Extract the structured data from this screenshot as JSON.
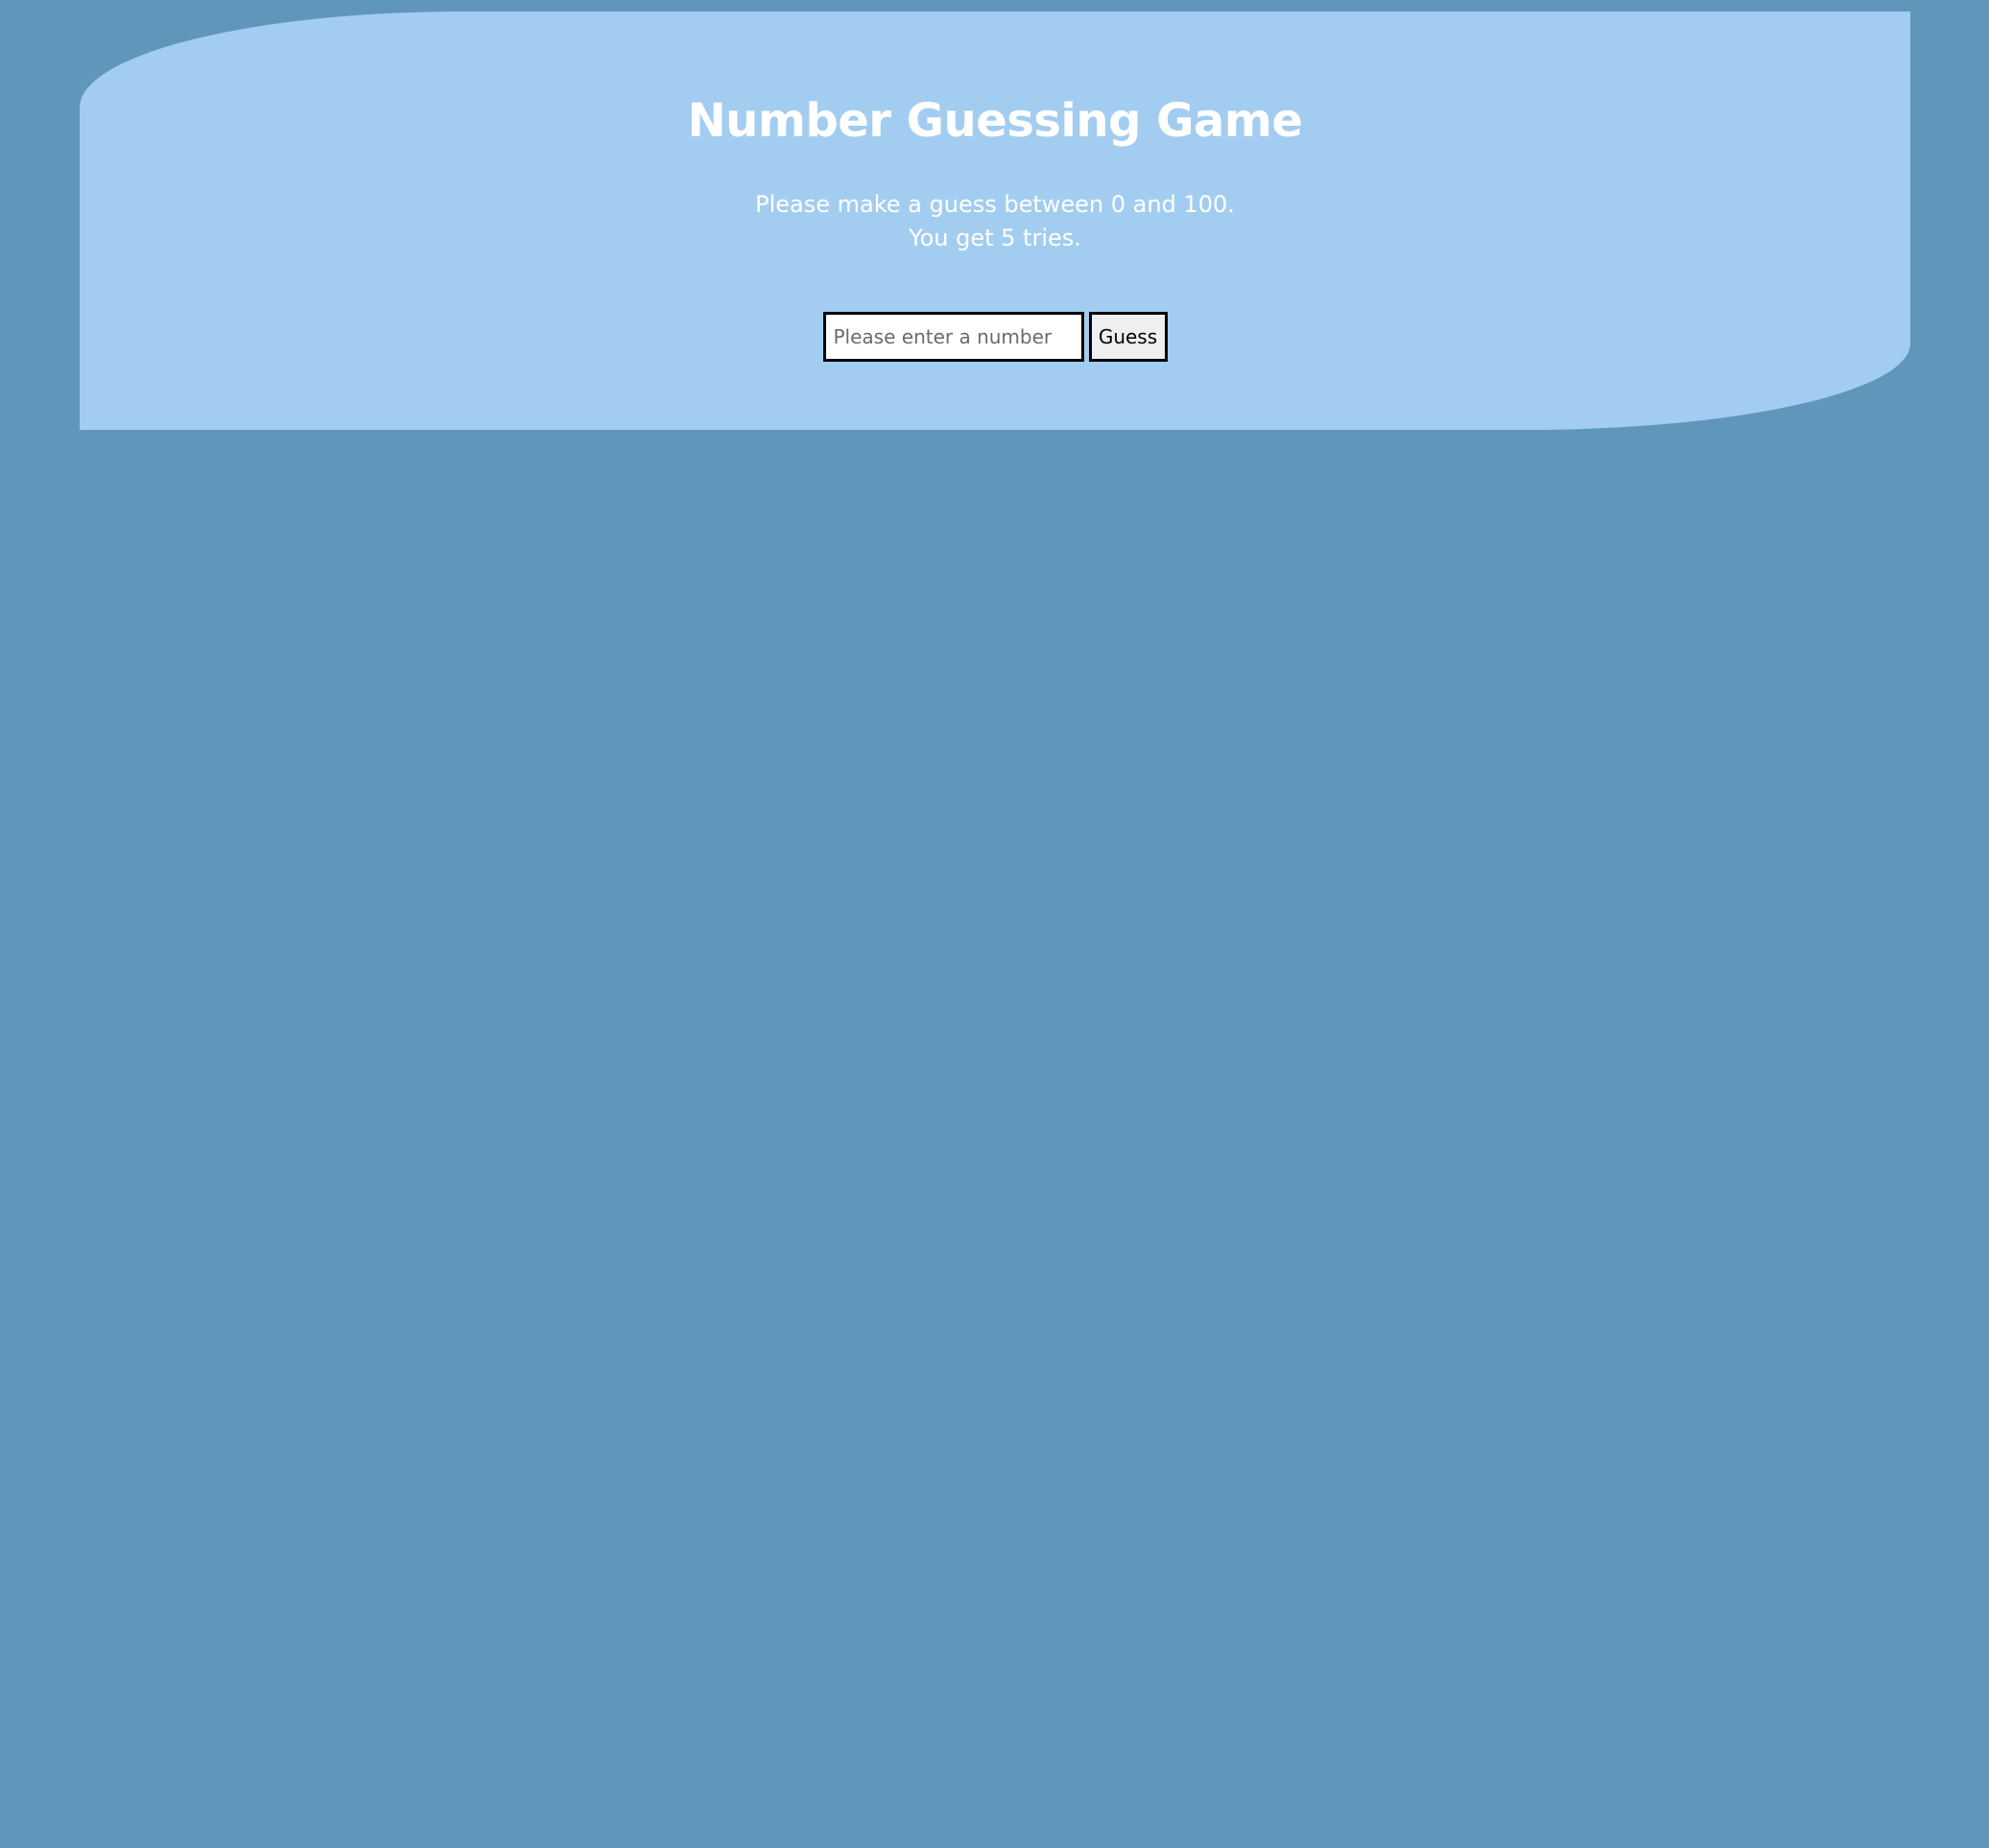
{
  "game": {
    "title": "Number Guessing Game",
    "instructions_line1": "Please make a guess between 0 and 100.",
    "instructions_line2": "You get 5 tries.",
    "input_placeholder": "Please enter a number",
    "input_value": "",
    "button_label": "Guess"
  },
  "colors": {
    "page_background": "#6196bb",
    "panel_background": "#a3cdf0",
    "text": "#ffffff",
    "input_border": "#000000",
    "button_background": "#efefef"
  }
}
